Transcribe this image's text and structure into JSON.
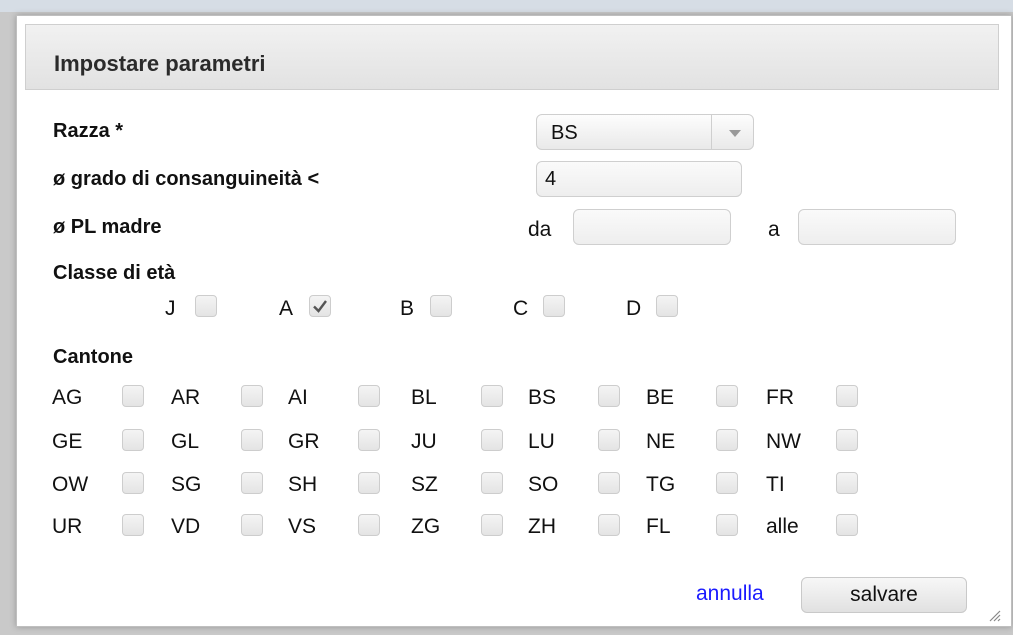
{
  "dialog": {
    "title": "Impostare parametri"
  },
  "fields": {
    "razza_label": "Razza *",
    "razza_value": "BS",
    "consanguineita_label": "ø grado di consanguineità <",
    "consanguineita_value": "4",
    "pl_madre_label": "ø PL madre",
    "da_label": "da",
    "da_value": "",
    "a_label": "a",
    "a_value": ""
  },
  "age_class": {
    "label": "Classe di età",
    "items": [
      {
        "label": "J",
        "checked": false
      },
      {
        "label": "A",
        "checked": true
      },
      {
        "label": "B",
        "checked": false
      },
      {
        "label": "C",
        "checked": false
      },
      {
        "label": "D",
        "checked": false
      }
    ]
  },
  "cantone": {
    "label": "Cantone",
    "rows": [
      [
        "AG",
        "AR",
        "AI",
        "BL",
        "BS",
        "BE",
        "FR"
      ],
      [
        "GE",
        "GL",
        "GR",
        "JU",
        "LU",
        "NE",
        "NW"
      ],
      [
        "OW",
        "SG",
        "SH",
        "SZ",
        "SO",
        "TG",
        "TI"
      ],
      [
        "UR",
        "VD",
        "VS",
        "ZG",
        "ZH",
        "FL",
        "alle"
      ]
    ]
  },
  "actions": {
    "cancel_label": "annulla",
    "save_label": "salvare"
  },
  "colors": {
    "link": "#1a1aff",
    "check": "#555555"
  },
  "icons": {
    "dropdown": "chevron-down-icon",
    "check": "checkmark-icon",
    "resize": "resize-grip-icon"
  }
}
